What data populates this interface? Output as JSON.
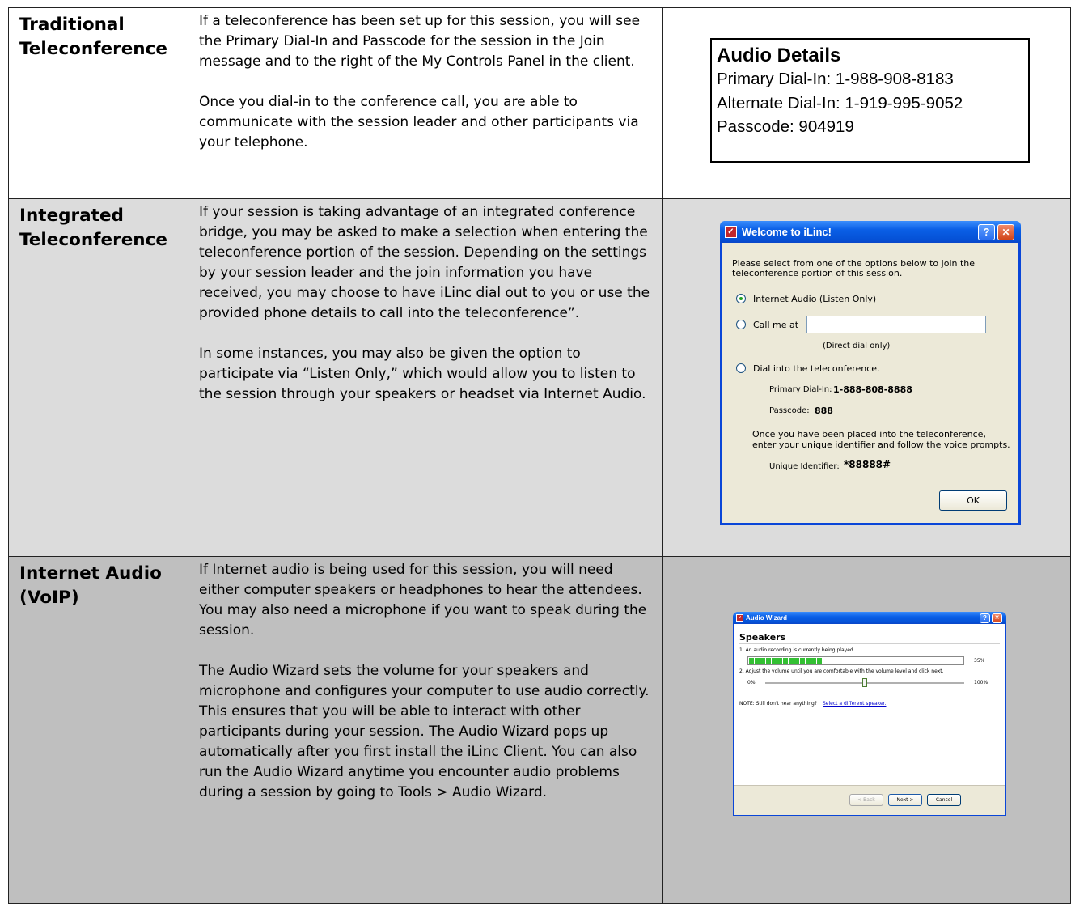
{
  "rows": [
    {
      "title": "Traditional Teleconference",
      "paragraphs": [
        "If a teleconference has been set up for this session, you will see the Primary Dial-In and Passcode for the session in the Join message and to the right of the My Controls Panel in the client.",
        "Once you dial-in to the conference call, you are able to communicate with the session leader and other participants via your telephone."
      ]
    },
    {
      "title": "Integrated Teleconference",
      "paragraphs": [
        "If your session is taking advantage of an integrated conference bridge, you may be asked to make a selection when entering the teleconference portion of the session. Depending on the settings by your session leader and the join information you have received, you may choose to have iLinc dial out to you or use the provided phone details to call into the teleconference”.",
        "In some instances, you may also be given the option to participate via “Listen Only,” which would allow you to listen to the session through your speakers or headset via Internet Audio."
      ]
    },
    {
      "title": "Internet Audio (VoIP)",
      "paragraphs": [
        "If Internet audio is being used for this session, you will need either computer speakers or headphones to hear the attendees. You may also need a microphone if you want to speak during the session.",
        "The Audio Wizard sets the volume for your speakers and microphone and configures your computer to use audio correctly. This ensures that you will be able to interact with other participants during your session. The Audio Wizard pops up automatically after you first install the iLinc Client. You can also run the Audio Wizard anytime you encounter audio problems during a session by going to Tools > Audio Wizard."
      ]
    }
  ],
  "audio_details": {
    "title": "Audio Details",
    "primary": "Primary Dial-In: 1-988-908-8183",
    "alternate": "Alternate Dial-In: 1-919-995-9052",
    "passcode": "Passcode: 904919"
  },
  "welcome_dialog": {
    "title": "Welcome to iLinc!",
    "help_glyph": "?",
    "close_glyph": "✕",
    "intro_line1": "Please select from one of the options below to join the",
    "intro_line2": "teleconference portion of this session.",
    "opt_internet": "Internet Audio (Listen Only)",
    "opt_call": "Call me at",
    "call_value": "",
    "direct_note": "(Direct dial only)",
    "opt_dial": "Dial into the teleconference.",
    "primary_label": "Primary Dial-In:",
    "primary_value": "1-888-808-8888",
    "passcode_label": "Passcode:",
    "passcode_value": "888",
    "placed_line1": "Once you have been placed into the teleconference,",
    "placed_line2": "enter your unique identifier and follow the voice prompts.",
    "uid_label": "Unique Identifier:",
    "uid_value": "*88888#",
    "ok": "OK"
  },
  "audio_wizard": {
    "title": "Audio Wizard",
    "heading": "Speakers",
    "step1": "1.  An audio recording is currently being played.",
    "progress_label": "35%",
    "progress_value": 0.35,
    "step2": "2.  Adjust the volume until you are comfortable with the volume level and click next.",
    "min": "0%",
    "max": "100%",
    "slider_value": 0.5,
    "note": "NOTE:  Still don't hear anything?",
    "note_link": "Select a different speaker.",
    "back": "< Back",
    "next": "Next >",
    "cancel": "Cancel"
  }
}
